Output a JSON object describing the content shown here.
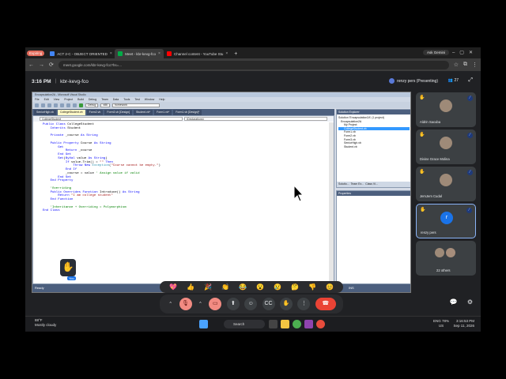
{
  "browser": {
    "tabs": [
      {
        "label": "ACT 2-C - OBJECT ORIENTED",
        "icon": "gdocs-icon",
        "color": "#4285f4",
        "active": false
      },
      {
        "label": "Meet - kbr-kevg-fco",
        "icon": "meet-icon",
        "color": "#00ac47",
        "active": true
      },
      {
        "label": "Channel content - YouTube Stu",
        "icon": "youtube-icon",
        "color": "#ff0000",
        "active": false
      }
    ],
    "expiring_pill": "Expiring",
    "ask_gemini": "Ask Gemini",
    "url": "meet.google.com/kbr-kevg-fco?hs=...",
    "tab_close": "×"
  },
  "meet": {
    "time": "3:16 PM",
    "separator": "|",
    "code": "kbr-kevg-fco",
    "presenter": "renzy pers (Presenting)",
    "participant_count": "27",
    "participants": [
      {
        "name": "Aldrin Sacuba",
        "hand": true,
        "muted": true
      },
      {
        "name": "Divine Grace Molina",
        "hand": true,
        "muted": true
      },
      {
        "name": "JemJem Cudal",
        "hand": true,
        "muted": true
      },
      {
        "name": "renzy pers",
        "initial": "r",
        "hand": true,
        "muted": true
      },
      {
        "name": "22 others",
        "hand": false,
        "muted": false
      }
    ],
    "you_label": "You",
    "reactions": [
      "💖",
      "👍",
      "🎉",
      "👏",
      "😂",
      "😮",
      "😢",
      "🤔",
      "👎",
      "😊"
    ]
  },
  "vs": {
    "title": "Encapsulation2A - Microsoft Visual Studio",
    "menu": [
      "File",
      "Edit",
      "View",
      "Project",
      "Build",
      "Debug",
      "Team",
      "Data",
      "Tools",
      "Test",
      "Window",
      "Help"
    ],
    "toolbar_selects": [
      "Debug",
      "x86",
      "homework"
    ],
    "doc_tabs": [
      "SeniorHigh.vb",
      "CollegeStudent.vb",
      "Form2.vb",
      "Form3.vb [Design]",
      "Student.vb*",
      "Form1.vb*",
      "Form1.vb [Design]*"
    ],
    "dropdowns": [
      "CollegeStudent",
      "(Declarations)"
    ],
    "code_lines": [
      "Public Class CollegeStudent",
      "    Inherits Student",
      "",
      "    Private _course As String",
      "",
      "    Public Property Course As String",
      "        Get",
      "            Return _course",
      "        End Get",
      "        Set(ByVal value As String)",
      "            If value.Trim() = \"\" Then",
      "                Throw New Exception(\"Course cannot be empty.\")",
      "            End If",
      "            _course = value ' Assign value if valid",
      "        End Set",
      "    End Property",
      "",
      "    'Overriding",
      "    Public Overrides Function Introduce() As String",
      "        Return \"I am college student\"",
      "    End Function",
      "",
      "    'Inheritance + Overriding = Polymorphism",
      "End Class"
    ],
    "solution_title": "Solution Explorer",
    "solution_items": [
      "Solution 'Encapsulation2A' (1 project)",
      "Encapsulation2A",
      "My Project",
      "CollegeStudent.vb",
      "Form1.vb",
      "Form2.vb",
      "Form3.vb",
      "SeniorHigh.vb",
      "Student.vb"
    ],
    "solution_tabs": [
      "Solutio...",
      "Team Ex...",
      "Class Vi..."
    ],
    "properties_title": "Properties",
    "status_ready": "Ready",
    "status_line": "Ln 3",
    "status_ins": "INS"
  },
  "controls": [
    "more-icon",
    "mic-off-icon",
    "more-icon",
    "camera-off-icon",
    "present-icon",
    "emoji-icon",
    "captions-icon",
    "raise-hand-icon",
    "more-vert-icon",
    "hang-up-icon"
  ],
  "taskbar": {
    "temp": "88°F",
    "weather": "Mostly cloudy",
    "search": "Search",
    "lang": "ENG",
    "region": "US",
    "battery": "78%",
    "time": "3:16:53 PM",
    "date": "Sep 11, 2026"
  }
}
